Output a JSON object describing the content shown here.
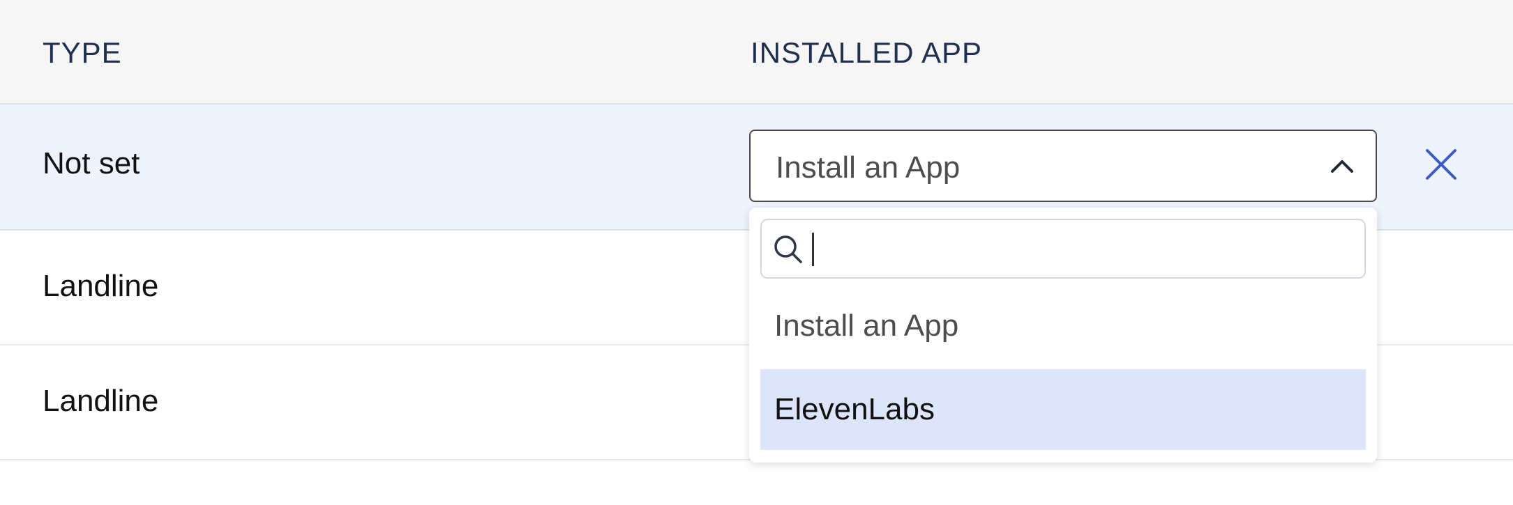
{
  "header": {
    "type_label": "TYPE",
    "installed_app_label": "INSTALLED APP"
  },
  "rows": [
    {
      "type": "Not set",
      "selected": true
    },
    {
      "type": "Landline"
    },
    {
      "type": "Landline"
    }
  ],
  "select": {
    "value": "Install an App",
    "expanded": true
  },
  "dropdown": {
    "search_value": "",
    "options": [
      {
        "label": "Install an App"
      },
      {
        "label": "ElevenLabs",
        "highlighted": true
      }
    ]
  },
  "icons": {
    "chevron": "chevron-up-icon",
    "remove": "close-icon",
    "search": "search-icon"
  },
  "colors": {
    "header_text": "#22304f",
    "selected_row_bg": "#eef3fe",
    "highlight_option_bg": "#dde5fb",
    "remove_icon": "#3a5bc7"
  }
}
